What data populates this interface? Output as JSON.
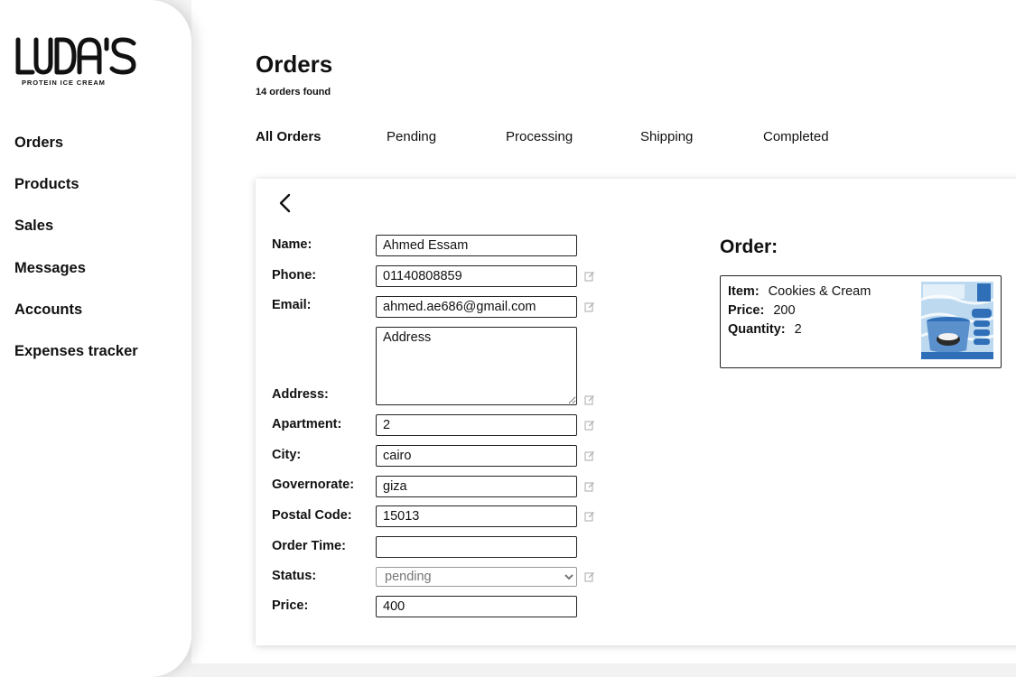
{
  "brand": {
    "logo_text": "LUDA'S",
    "tagline": "PROTEIN ICE CREAM"
  },
  "sidebar": {
    "items": [
      {
        "label": "Orders"
      },
      {
        "label": "Products"
      },
      {
        "label": "Sales"
      },
      {
        "label": "Messages"
      },
      {
        "label": "Accounts"
      },
      {
        "label": "Expenses tracker"
      }
    ]
  },
  "header": {
    "title": "Orders",
    "count_text": "14 orders found"
  },
  "tabs": [
    {
      "label": "All Orders",
      "active": true
    },
    {
      "label": "Pending",
      "active": false
    },
    {
      "label": "Processing",
      "active": false
    },
    {
      "label": "Shipping",
      "active": false
    },
    {
      "label": "Completed",
      "active": false
    }
  ],
  "form": {
    "name": {
      "label": "Name:",
      "value": "Ahmed Essam"
    },
    "phone": {
      "label": "Phone:",
      "value": "01140808859"
    },
    "email": {
      "label": "Email:",
      "value": "ahmed.ae686@gmail.com"
    },
    "address": {
      "label": "Address:",
      "placeholder": "Address",
      "value": ""
    },
    "apartment": {
      "label": "Apartment:",
      "value": "2"
    },
    "city": {
      "label": "City:",
      "value": "cairo"
    },
    "governorate": {
      "label": "Governorate:",
      "value": "giza"
    },
    "postal_code": {
      "label": "Postal Code:",
      "value": "15013"
    },
    "order_time": {
      "label": "Order Time:",
      "value": ""
    },
    "status": {
      "label": "Status:",
      "value": "pending"
    },
    "price": {
      "label": "Price:",
      "value": "400"
    }
  },
  "order": {
    "title": "Order:",
    "item_label": "Item:",
    "item_value": "Cookies & Cream",
    "price_label": "Price:",
    "price_value": "200",
    "quantity_label": "Quantity:",
    "quantity_value": "2"
  },
  "colors": {
    "accent_blue": "#2f6fb8",
    "light_blue": "#bcd9f0",
    "text": "#111111"
  },
  "icons": {
    "back": "chevron-left-icon",
    "edit": "edit-icon"
  }
}
